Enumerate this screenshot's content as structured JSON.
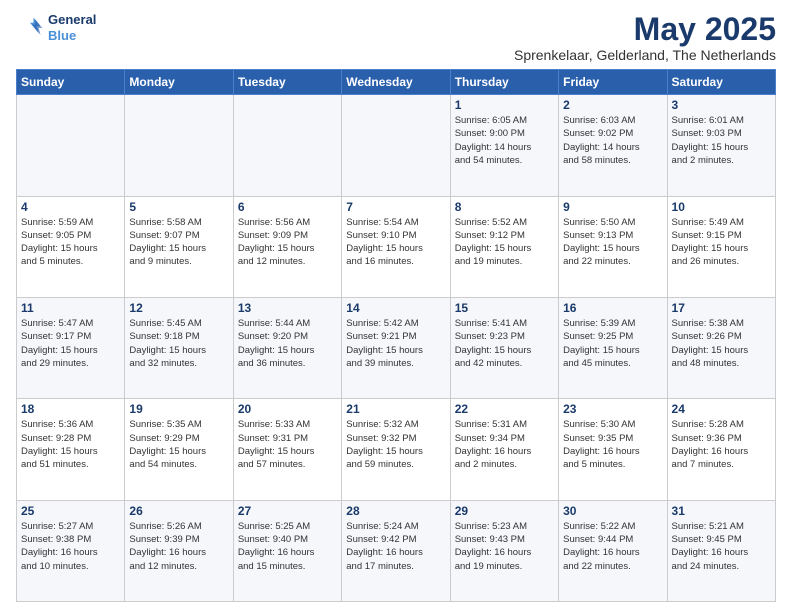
{
  "logo": {
    "line1": "General",
    "line2": "Blue"
  },
  "title": "May 2025",
  "subtitle": "Sprenkelaar, Gelderland, The Netherlands",
  "days_of_week": [
    "Sunday",
    "Monday",
    "Tuesday",
    "Wednesday",
    "Thursday",
    "Friday",
    "Saturday"
  ],
  "weeks": [
    [
      {
        "day": "",
        "info": ""
      },
      {
        "day": "",
        "info": ""
      },
      {
        "day": "",
        "info": ""
      },
      {
        "day": "",
        "info": ""
      },
      {
        "day": "1",
        "info": "Sunrise: 6:05 AM\nSunset: 9:00 PM\nDaylight: 14 hours\nand 54 minutes."
      },
      {
        "day": "2",
        "info": "Sunrise: 6:03 AM\nSunset: 9:02 PM\nDaylight: 14 hours\nand 58 minutes."
      },
      {
        "day": "3",
        "info": "Sunrise: 6:01 AM\nSunset: 9:03 PM\nDaylight: 15 hours\nand 2 minutes."
      }
    ],
    [
      {
        "day": "4",
        "info": "Sunrise: 5:59 AM\nSunset: 9:05 PM\nDaylight: 15 hours\nand 5 minutes."
      },
      {
        "day": "5",
        "info": "Sunrise: 5:58 AM\nSunset: 9:07 PM\nDaylight: 15 hours\nand 9 minutes."
      },
      {
        "day": "6",
        "info": "Sunrise: 5:56 AM\nSunset: 9:09 PM\nDaylight: 15 hours\nand 12 minutes."
      },
      {
        "day": "7",
        "info": "Sunrise: 5:54 AM\nSunset: 9:10 PM\nDaylight: 15 hours\nand 16 minutes."
      },
      {
        "day": "8",
        "info": "Sunrise: 5:52 AM\nSunset: 9:12 PM\nDaylight: 15 hours\nand 19 minutes."
      },
      {
        "day": "9",
        "info": "Sunrise: 5:50 AM\nSunset: 9:13 PM\nDaylight: 15 hours\nand 22 minutes."
      },
      {
        "day": "10",
        "info": "Sunrise: 5:49 AM\nSunset: 9:15 PM\nDaylight: 15 hours\nand 26 minutes."
      }
    ],
    [
      {
        "day": "11",
        "info": "Sunrise: 5:47 AM\nSunset: 9:17 PM\nDaylight: 15 hours\nand 29 minutes."
      },
      {
        "day": "12",
        "info": "Sunrise: 5:45 AM\nSunset: 9:18 PM\nDaylight: 15 hours\nand 32 minutes."
      },
      {
        "day": "13",
        "info": "Sunrise: 5:44 AM\nSunset: 9:20 PM\nDaylight: 15 hours\nand 36 minutes."
      },
      {
        "day": "14",
        "info": "Sunrise: 5:42 AM\nSunset: 9:21 PM\nDaylight: 15 hours\nand 39 minutes."
      },
      {
        "day": "15",
        "info": "Sunrise: 5:41 AM\nSunset: 9:23 PM\nDaylight: 15 hours\nand 42 minutes."
      },
      {
        "day": "16",
        "info": "Sunrise: 5:39 AM\nSunset: 9:25 PM\nDaylight: 15 hours\nand 45 minutes."
      },
      {
        "day": "17",
        "info": "Sunrise: 5:38 AM\nSunset: 9:26 PM\nDaylight: 15 hours\nand 48 minutes."
      }
    ],
    [
      {
        "day": "18",
        "info": "Sunrise: 5:36 AM\nSunset: 9:28 PM\nDaylight: 15 hours\nand 51 minutes."
      },
      {
        "day": "19",
        "info": "Sunrise: 5:35 AM\nSunset: 9:29 PM\nDaylight: 15 hours\nand 54 minutes."
      },
      {
        "day": "20",
        "info": "Sunrise: 5:33 AM\nSunset: 9:31 PM\nDaylight: 15 hours\nand 57 minutes."
      },
      {
        "day": "21",
        "info": "Sunrise: 5:32 AM\nSunset: 9:32 PM\nDaylight: 15 hours\nand 59 minutes."
      },
      {
        "day": "22",
        "info": "Sunrise: 5:31 AM\nSunset: 9:34 PM\nDaylight: 16 hours\nand 2 minutes."
      },
      {
        "day": "23",
        "info": "Sunrise: 5:30 AM\nSunset: 9:35 PM\nDaylight: 16 hours\nand 5 minutes."
      },
      {
        "day": "24",
        "info": "Sunrise: 5:28 AM\nSunset: 9:36 PM\nDaylight: 16 hours\nand 7 minutes."
      }
    ],
    [
      {
        "day": "25",
        "info": "Sunrise: 5:27 AM\nSunset: 9:38 PM\nDaylight: 16 hours\nand 10 minutes."
      },
      {
        "day": "26",
        "info": "Sunrise: 5:26 AM\nSunset: 9:39 PM\nDaylight: 16 hours\nand 12 minutes."
      },
      {
        "day": "27",
        "info": "Sunrise: 5:25 AM\nSunset: 9:40 PM\nDaylight: 16 hours\nand 15 minutes."
      },
      {
        "day": "28",
        "info": "Sunrise: 5:24 AM\nSunset: 9:42 PM\nDaylight: 16 hours\nand 17 minutes."
      },
      {
        "day": "29",
        "info": "Sunrise: 5:23 AM\nSunset: 9:43 PM\nDaylight: 16 hours\nand 19 minutes."
      },
      {
        "day": "30",
        "info": "Sunrise: 5:22 AM\nSunset: 9:44 PM\nDaylight: 16 hours\nand 22 minutes."
      },
      {
        "day": "31",
        "info": "Sunrise: 5:21 AM\nSunset: 9:45 PM\nDaylight: 16 hours\nand 24 minutes."
      }
    ]
  ]
}
